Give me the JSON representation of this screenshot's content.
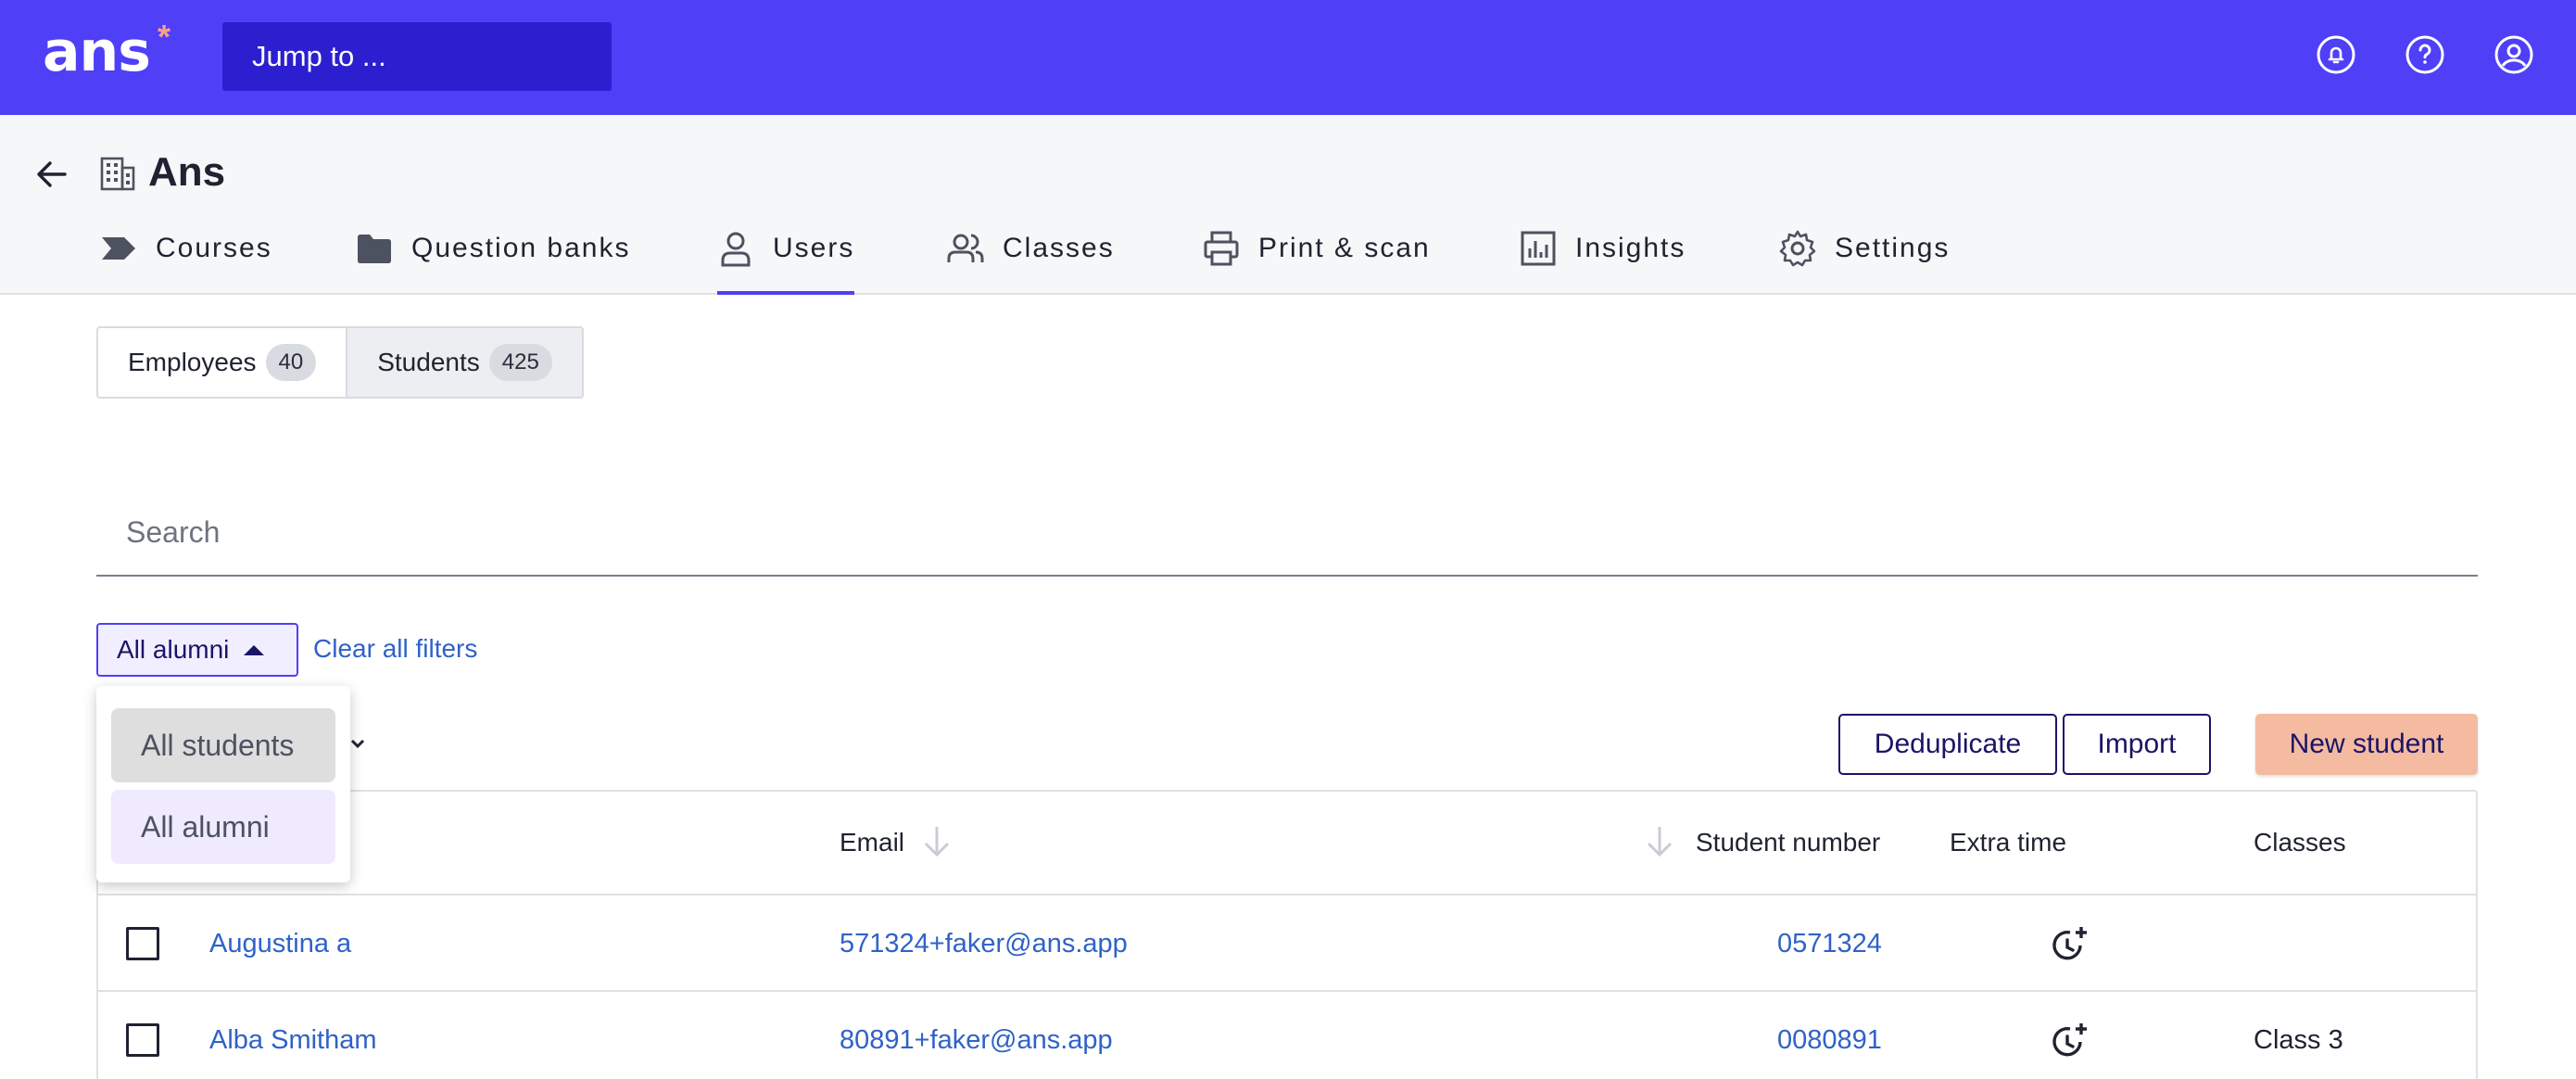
{
  "app": {
    "logo_text": "ans",
    "logo_mark": "*",
    "jump_placeholder": "Jump to ..."
  },
  "topbar_icons": [
    "bell-icon",
    "help-icon",
    "account-icon"
  ],
  "header": {
    "org_name": "Ans"
  },
  "tabs": [
    {
      "label": "Courses",
      "icon": "course-tag-icon"
    },
    {
      "label": "Question banks",
      "icon": "folder-icon"
    },
    {
      "label": "Users",
      "icon": "user-icon",
      "active": true
    },
    {
      "label": "Classes",
      "icon": "users-icon"
    },
    {
      "label": "Print & scan",
      "icon": "printer-icon"
    },
    {
      "label": "Insights",
      "icon": "chart-icon"
    },
    {
      "label": "Settings",
      "icon": "gear-icon"
    }
  ],
  "segments": [
    {
      "label": "Employees",
      "count": "40"
    },
    {
      "label": "Students",
      "count": "425",
      "active": true
    }
  ],
  "search": {
    "placeholder": "Search"
  },
  "filter": {
    "label": "All alumni",
    "clear_label": "Clear all filters"
  },
  "dropdown": {
    "options": [
      "All students",
      "All alumni"
    ],
    "selected": "All alumni"
  },
  "actions": {
    "deduplicate": "Deduplicate",
    "import": "Import",
    "new_student": "New student"
  },
  "table": {
    "columns": {
      "email": "Email",
      "student_number": "Student number",
      "extra_time": "Extra time",
      "classes": "Classes"
    },
    "rows": [
      {
        "name": "Augustina a",
        "email": "571324+faker@ans.app",
        "student_number": "0571324",
        "classes": ""
      },
      {
        "name": "Alba Smitham",
        "email": "80891+faker@ans.app",
        "student_number": "0080891",
        "classes": "Class 3"
      }
    ]
  },
  "colors": {
    "brand": "#4f3ff7",
    "link": "#2f62c8",
    "accent": "#f4bba1"
  }
}
